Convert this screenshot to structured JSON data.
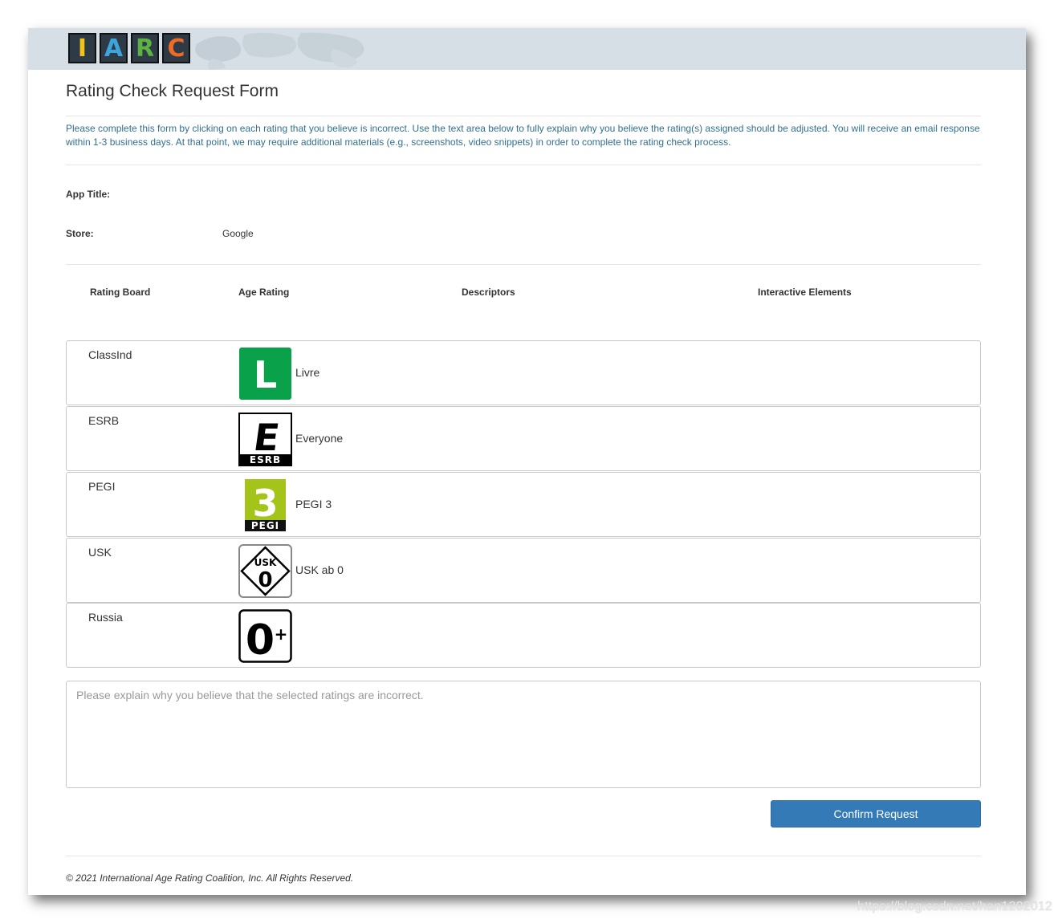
{
  "logo": {
    "letters": [
      "I",
      "A",
      "R",
      "C"
    ],
    "colors": [
      "#f2c318",
      "#3ea4dc",
      "#5db244",
      "#ef6b25"
    ]
  },
  "page_title": "Rating Check Request Form",
  "intro": "Please complete this form by clicking on each rating that you believe is incorrect. Use the text area below to fully explain why you believe the rating(s) assigned should be adjusted. You will receive an email response within 1-3 business days. At that point, we may require additional materials (e.g., screenshots, video snippets) in order to complete the rating check process.",
  "info": {
    "app_title_label": "App Title:",
    "app_title_value": "",
    "store_label": "Store:",
    "store_value": "Google"
  },
  "table": {
    "headers": {
      "board": "Rating Board",
      "age": "Age Rating",
      "descriptors": "Descriptors",
      "interactive": "Interactive Elements"
    },
    "rows": [
      {
        "board": "ClassInd",
        "icon": "classind-l-icon",
        "age_text": "Livre",
        "badge_text": "L"
      },
      {
        "board": "ESRB",
        "icon": "esrb-e-icon",
        "age_text": "Everyone",
        "badge_text": "E",
        "badge_sub": "ESRB"
      },
      {
        "board": "PEGI",
        "icon": "pegi-3-icon",
        "age_text": "PEGI 3",
        "badge_text": "3",
        "badge_sub": "PEGI"
      },
      {
        "board": "USK",
        "icon": "usk-0-icon",
        "age_text": "USK ab 0",
        "badge_text": "0",
        "badge_sub": "USK"
      },
      {
        "board": "Russia",
        "icon": "russia-0plus-icon",
        "age_text": "",
        "badge_text": "0",
        "badge_sup": "+"
      }
    ]
  },
  "explain": {
    "placeholder": "Please explain why you believe that the selected ratings are incorrect.",
    "value": ""
  },
  "confirm_label": "Confirm Request",
  "footer": "© 2021 International Age Rating Coalition, Inc. All Rights Reserved.",
  "watermark": "https://blog.csdn.net/han1202012",
  "colors": {
    "header_band": "#d6dfe5",
    "intro_text": "#31708f",
    "primary_button": "#337ab7",
    "classind_green": "#0aa14b",
    "pegi_green": "#a4c419"
  }
}
